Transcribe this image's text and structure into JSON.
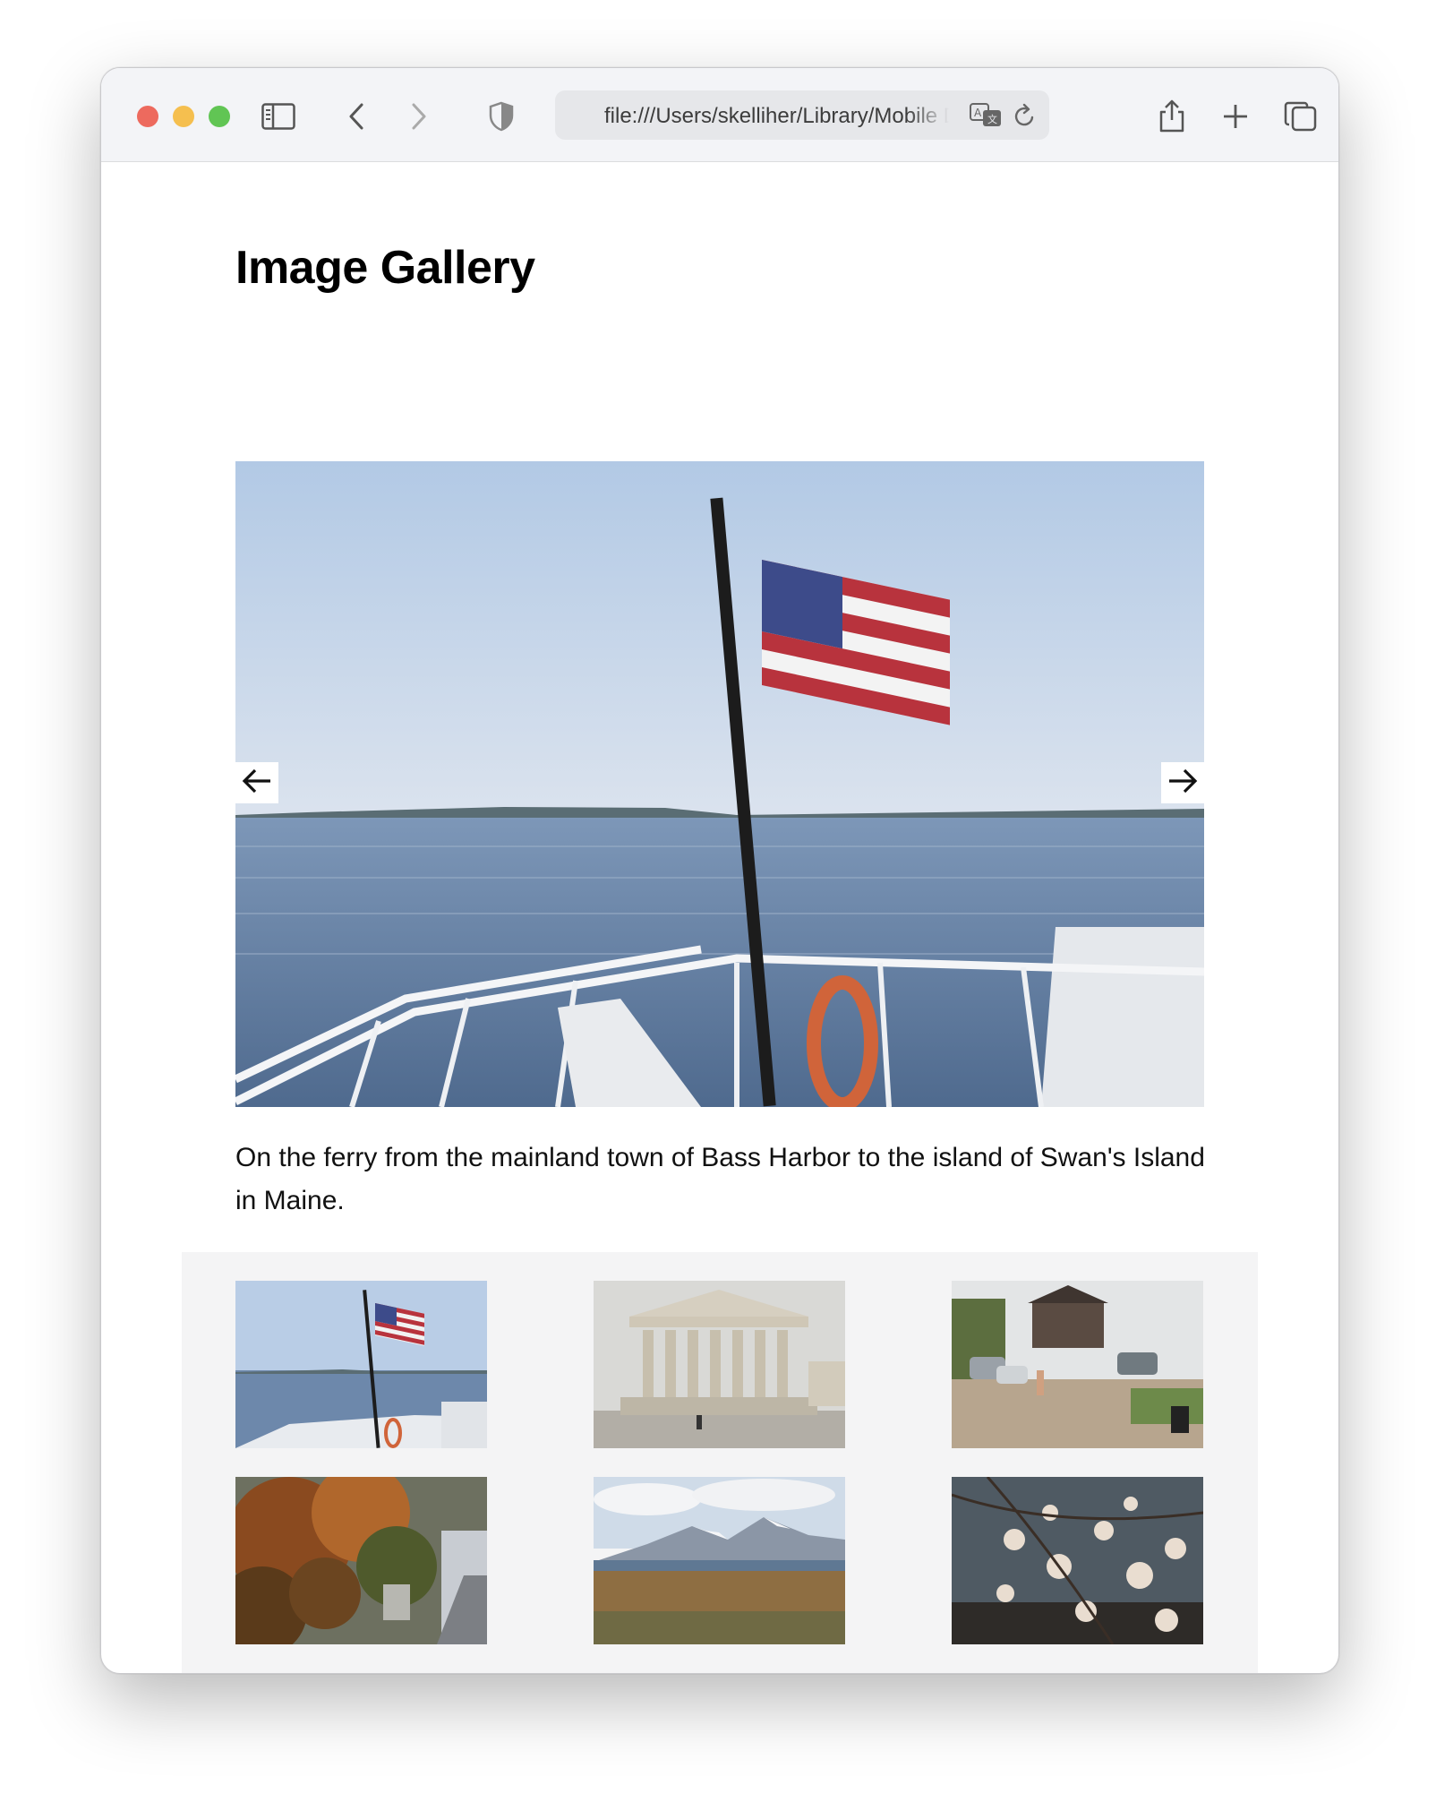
{
  "browser": {
    "url": "file:///Users/skelliher/Library/Mobile Documents/com~apple~CloudDocs/image-gallery/index.html",
    "icons": [
      "sidebar-icon",
      "back-icon",
      "forward-icon",
      "shield-icon",
      "translate-icon",
      "reload-icon",
      "share-icon",
      "new-tab-icon",
      "tab-overview-icon"
    ]
  },
  "page": {
    "title": "Image Gallery",
    "caption": "On the ferry from the mainland town of Bass Harbor to the island of Swan's Island in Maine."
  },
  "gallery": {
    "prev_icon": "arrow-left-icon",
    "next_icon": "arrow-right-icon",
    "selected_index": 0,
    "thumbnails": [
      {
        "subject": "ferry-flag"
      },
      {
        "subject": "supreme-court"
      },
      {
        "subject": "town-street"
      },
      {
        "subject": "autumn-road"
      },
      {
        "subject": "mountain-lake"
      },
      {
        "subject": "blossoms-water"
      }
    ]
  },
  "colors": {
    "toolbar_bg": "#f3f4f7",
    "address_bg": "#e6e7ea",
    "thumb_panel_bg": "#f4f4f5",
    "traffic_red": "#ed6a5e",
    "traffic_yellow": "#f5bf4f",
    "traffic_green": "#61c554"
  }
}
